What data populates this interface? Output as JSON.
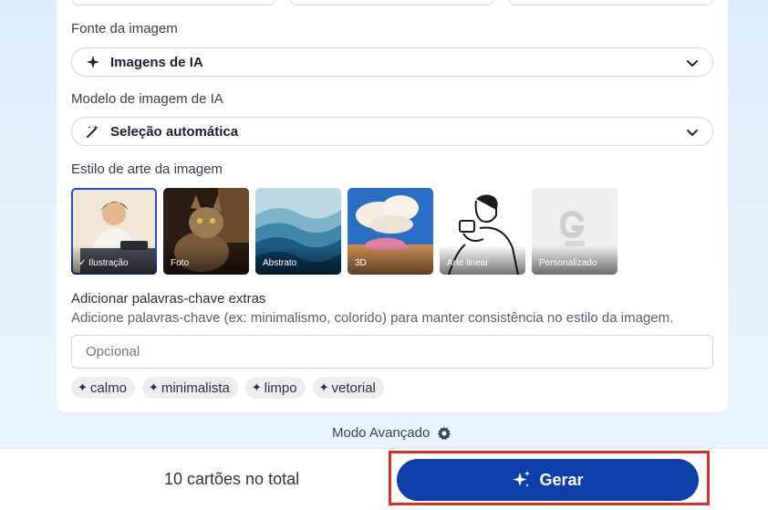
{
  "image_source": {
    "label": "Fonte da imagem",
    "value": "Imagens de IA",
    "icon": "sparkle-icon"
  },
  "model": {
    "label": "Modelo de imagem de IA",
    "value": "Seleção automática",
    "icon": "magic-wand-icon"
  },
  "art_style": {
    "label": "Estilo de arte da imagem",
    "options": [
      {
        "label": "Ilustração",
        "selected": true
      },
      {
        "label": "Foto",
        "selected": false
      },
      {
        "label": "Abstrato",
        "selected": false
      },
      {
        "label": "3D",
        "selected": false
      },
      {
        "label": "Arte linear",
        "selected": false
      },
      {
        "label": "Personalizado",
        "selected": false
      }
    ]
  },
  "keywords": {
    "title": "Adicionar palavras-chave extras",
    "description": "Adicione palavras-chave (ex: minimalismo, colorido) para manter consistência no estilo da imagem.",
    "placeholder": "Opcional",
    "suggestions": [
      "calmo",
      "minimalista",
      "limpo",
      "vetorial"
    ]
  },
  "advanced_mode": {
    "label": "Modo Avançado",
    "icon": "gear-icon"
  },
  "footer": {
    "total": "10 cartões no total",
    "generate_label": "Gerar",
    "generate_icon": "sparkles-icon"
  },
  "colors": {
    "primary": "#0f3fa8",
    "selected_outline": "#2350c9",
    "highlight": "#d32f2f"
  }
}
